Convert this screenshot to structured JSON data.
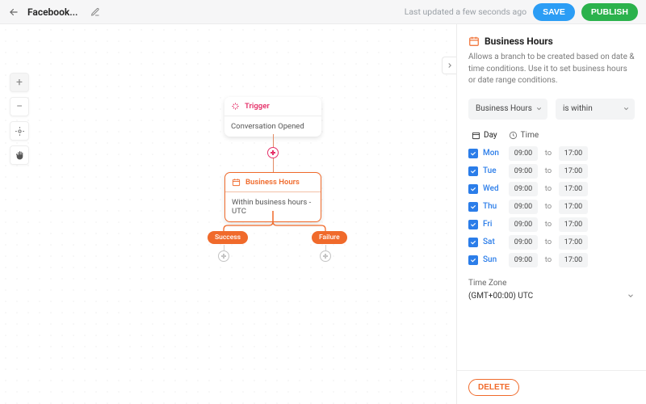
{
  "header": {
    "title": "Facebook...",
    "updated": "Last updated a few seconds ago",
    "save": "SAVE",
    "publish": "PUBLISH"
  },
  "canvas": {
    "trigger": {
      "title": "Trigger",
      "body": "Conversation Opened"
    },
    "bh_node": {
      "title": "Business Hours",
      "body": "Within business hours - UTC"
    },
    "branch": {
      "success": "Success",
      "failure": "Failure"
    }
  },
  "panel": {
    "title": "Business Hours",
    "description": "Allows a branch to be created based on date & time conditions. Use it to set business hours or date range conditions.",
    "dd1": "Business Hours",
    "dd2": "is within",
    "tabs": {
      "day": "Day",
      "time": "Time"
    },
    "days": [
      {
        "label": "Mon",
        "from": "09:00",
        "to_label": "to",
        "to": "17:00"
      },
      {
        "label": "Tue",
        "from": "09:00",
        "to_label": "to",
        "to": "17:00"
      },
      {
        "label": "Wed",
        "from": "09:00",
        "to_label": "to",
        "to": "17:00"
      },
      {
        "label": "Thu",
        "from": "09:00",
        "to_label": "to",
        "to": "17:00"
      },
      {
        "label": "Fri",
        "from": "09:00",
        "to_label": "to",
        "to": "17:00"
      },
      {
        "label": "Sat",
        "from": "09:00",
        "to_label": "to",
        "to": "17:00"
      },
      {
        "label": "Sun",
        "from": "09:00",
        "to_label": "to",
        "to": "17:00"
      }
    ],
    "tz_label": "Time Zone",
    "tz_value": "(GMT+00:00) UTC",
    "delete": "DELETE"
  }
}
